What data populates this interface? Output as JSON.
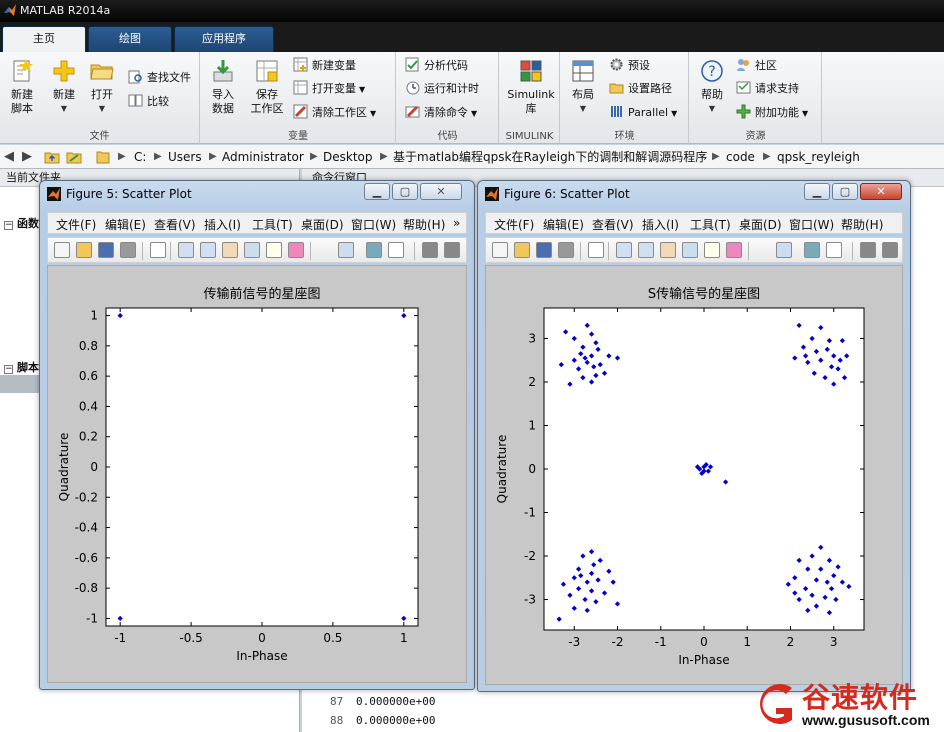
{
  "app": {
    "title": "MATLAB R2014a"
  },
  "main_tabs": [
    "主页",
    "绘图",
    "应用程序"
  ],
  "ribbon": {
    "file": {
      "label": "文件",
      "new_script": "新建\n脚本",
      "new": "新建",
      "open": "打开",
      "find_files": "查找文件",
      "compare": "比较"
    },
    "variable": {
      "label": "变量",
      "import": "导入\n数据",
      "save_ws": "保存\n工作区",
      "new_var": "新建变量",
      "open_var": "打开变量",
      "clear_ws": "清除工作区"
    },
    "code": {
      "label": "代码",
      "analyze": "分析代码",
      "run_time": "运行和计时",
      "clear_cmds": "清除命令"
    },
    "simulink": {
      "label": "SIMULINK",
      "lib": "Simulink\n库"
    },
    "env": {
      "label": "环境",
      "layout": "布局",
      "prefs": "预设",
      "set_path": "设置路径",
      "parallel": "Parallel"
    },
    "res": {
      "label": "资源",
      "help": "帮助",
      "community": "社区",
      "support": "请求支持",
      "addons": "附加功能"
    }
  },
  "address": {
    "drive": "C:",
    "parts": [
      "Users",
      "Administrator",
      "Desktop",
      "基于matlab编程qpsk在Rayleigh下的调制和解调源码程序",
      "code",
      "qpsk_reyleigh"
    ]
  },
  "left_panel": {
    "header": "当前文件夹",
    "row1": "函数",
    "row2": "脚本"
  },
  "cmd_panel": {
    "header": "命令行窗口",
    "lines": [
      {
        "n": "87",
        "v": "0.000000e+00"
      },
      {
        "n": "88",
        "v": "0.000000e+00"
      }
    ]
  },
  "fig_menu": [
    "文件(F)",
    "编辑(E)",
    "查看(V)",
    "插入(I)",
    "工具(T)",
    "桌面(D)",
    "窗口(W)",
    "帮助(H)"
  ],
  "figures": [
    {
      "title": "Figure 5: Scatter Plot",
      "chart_data": {
        "type": "scatter",
        "title": "传输前信号的星座图",
        "xlabel": "In-Phase",
        "ylabel": "Quadrature",
        "xlim": [
          -1.1,
          1.1
        ],
        "ylim": [
          -1.05,
          1.05
        ],
        "xticks": [
          "-1",
          "-0.5",
          "0",
          "0.5",
          "1"
        ],
        "xtick_values": [
          -1,
          -0.5,
          0,
          0.5,
          1
        ],
        "yticks": [
          "1",
          "0.8",
          "0.6",
          "0.4",
          "0.2",
          "0",
          "-0.2",
          "-0.4",
          "-0.6",
          "-0.8",
          "-1"
        ],
        "ytick_values": [
          1,
          0.8,
          0.6,
          0.4,
          0.2,
          0,
          -0.2,
          -0.4,
          -0.6,
          -0.8,
          -1
        ],
        "marker_color": "#0000cc",
        "points": [
          [
            -1,
            1
          ],
          [
            1,
            1
          ],
          [
            -1,
            -1
          ],
          [
            1,
            -1
          ]
        ]
      }
    },
    {
      "title": "Figure 6: Scatter Plot",
      "chart_data": {
        "type": "scatter",
        "title": "S传输信号的星座图",
        "xlabel": "In-Phase",
        "ylabel": "Quadrature",
        "xlim": [
          -3.7,
          3.7
        ],
        "ylim": [
          -3.7,
          3.7
        ],
        "xticks": [
          "-3",
          "-2",
          "-1",
          "0",
          "1",
          "2",
          "3"
        ],
        "xtick_values": [
          -3,
          -2,
          -1,
          0,
          1,
          2,
          3
        ],
        "yticks": [
          "3",
          "2",
          "1",
          "0",
          "-1",
          "-2",
          "-3"
        ],
        "ytick_values": [
          3,
          2,
          1,
          0,
          -1,
          -2,
          -3
        ],
        "marker_color": "#0000cc",
        "points": [
          [
            -3.2,
            3.15
          ],
          [
            -3.0,
            3.0
          ],
          [
            -2.7,
            3.3
          ],
          [
            -2.6,
            3.1
          ],
          [
            -2.5,
            2.9
          ],
          [
            -2.8,
            2.8
          ],
          [
            -3.3,
            2.4
          ],
          [
            -2.9,
            2.3
          ],
          [
            -2.6,
            2.6
          ],
          [
            -2.4,
            2.4
          ],
          [
            -2.2,
            2.6
          ],
          [
            -2.7,
            2.45
          ],
          [
            -3.1,
            1.95
          ],
          [
            -2.8,
            2.1
          ],
          [
            -2.5,
            2.15
          ],
          [
            -2.6,
            2.0
          ],
          [
            -2.3,
            2.2
          ],
          [
            -3.0,
            2.5
          ],
          [
            -2.75,
            2.55
          ],
          [
            -2.45,
            2.75
          ],
          [
            -2.55,
            2.35
          ],
          [
            -2.0,
            2.55
          ],
          [
            -2.85,
            2.65
          ],
          [
            2.2,
            3.3
          ],
          [
            2.5,
            3.0
          ],
          [
            2.7,
            3.25
          ],
          [
            2.9,
            2.95
          ],
          [
            3.2,
            2.95
          ],
          [
            2.3,
            2.8
          ],
          [
            2.6,
            2.7
          ],
          [
            3.0,
            2.6
          ],
          [
            2.1,
            2.55
          ],
          [
            2.4,
            2.45
          ],
          [
            2.7,
            2.5
          ],
          [
            2.95,
            2.35
          ],
          [
            3.15,
            2.5
          ],
          [
            3.3,
            2.6
          ],
          [
            2.55,
            2.2
          ],
          [
            2.8,
            2.1
          ],
          [
            3.0,
            1.95
          ],
          [
            3.25,
            2.1
          ],
          [
            2.35,
            2.6
          ],
          [
            2.85,
            2.75
          ],
          [
            3.1,
            2.3
          ],
          [
            0.0,
            0.05
          ],
          [
            -0.1,
            0.0
          ],
          [
            0.05,
            0.1
          ],
          [
            0.1,
            -0.05
          ],
          [
            -0.05,
            -0.1
          ],
          [
            0.15,
            0.05
          ],
          [
            -0.15,
            0.05
          ],
          [
            0.0,
            -0.05
          ],
          [
            0.5,
            -0.3
          ],
          [
            -2.6,
            -1.9
          ],
          [
            -2.8,
            -2.0
          ],
          [
            -2.4,
            -2.1
          ],
          [
            -2.9,
            -2.3
          ],
          [
            -2.6,
            -2.4
          ],
          [
            -2.2,
            -2.35
          ],
          [
            -3.0,
            -2.5
          ],
          [
            -2.7,
            -2.6
          ],
          [
            -2.45,
            -2.55
          ],
          [
            -2.1,
            -2.6
          ],
          [
            -3.25,
            -2.65
          ],
          [
            -2.9,
            -2.75
          ],
          [
            -2.6,
            -2.8
          ],
          [
            -2.3,
            -2.85
          ],
          [
            -3.1,
            -2.9
          ],
          [
            -2.75,
            -3.0
          ],
          [
            -2.5,
            -3.05
          ],
          [
            -2.0,
            -3.1
          ],
          [
            -3.0,
            -3.2
          ],
          [
            -2.7,
            -3.25
          ],
          [
            -3.35,
            -3.45
          ],
          [
            -2.85,
            -2.45
          ],
          [
            -2.55,
            -2.2
          ],
          [
            2.7,
            -1.8
          ],
          [
            2.5,
            -2.0
          ],
          [
            2.2,
            -2.1
          ],
          [
            2.9,
            -2.1
          ],
          [
            2.4,
            -2.3
          ],
          [
            2.7,
            -2.3
          ],
          [
            3.1,
            -2.25
          ],
          [
            2.1,
            -2.5
          ],
          [
            2.6,
            -2.55
          ],
          [
            2.85,
            -2.6
          ],
          [
            3.2,
            -2.6
          ],
          [
            1.95,
            -2.65
          ],
          [
            2.35,
            -2.75
          ],
          [
            2.95,
            -2.75
          ],
          [
            3.35,
            -2.7
          ],
          [
            2.5,
            -2.9
          ],
          [
            2.8,
            -2.95
          ],
          [
            2.2,
            -3.0
          ],
          [
            3.05,
            -3.0
          ],
          [
            2.6,
            -3.15
          ],
          [
            2.4,
            -3.25
          ],
          [
            2.9,
            -3.3
          ],
          [
            2.1,
            -2.85
          ],
          [
            3.0,
            -2.45
          ]
        ]
      }
    }
  ],
  "watermark": {
    "brand": "谷速软件",
    "url": "www.gususoft.com"
  }
}
